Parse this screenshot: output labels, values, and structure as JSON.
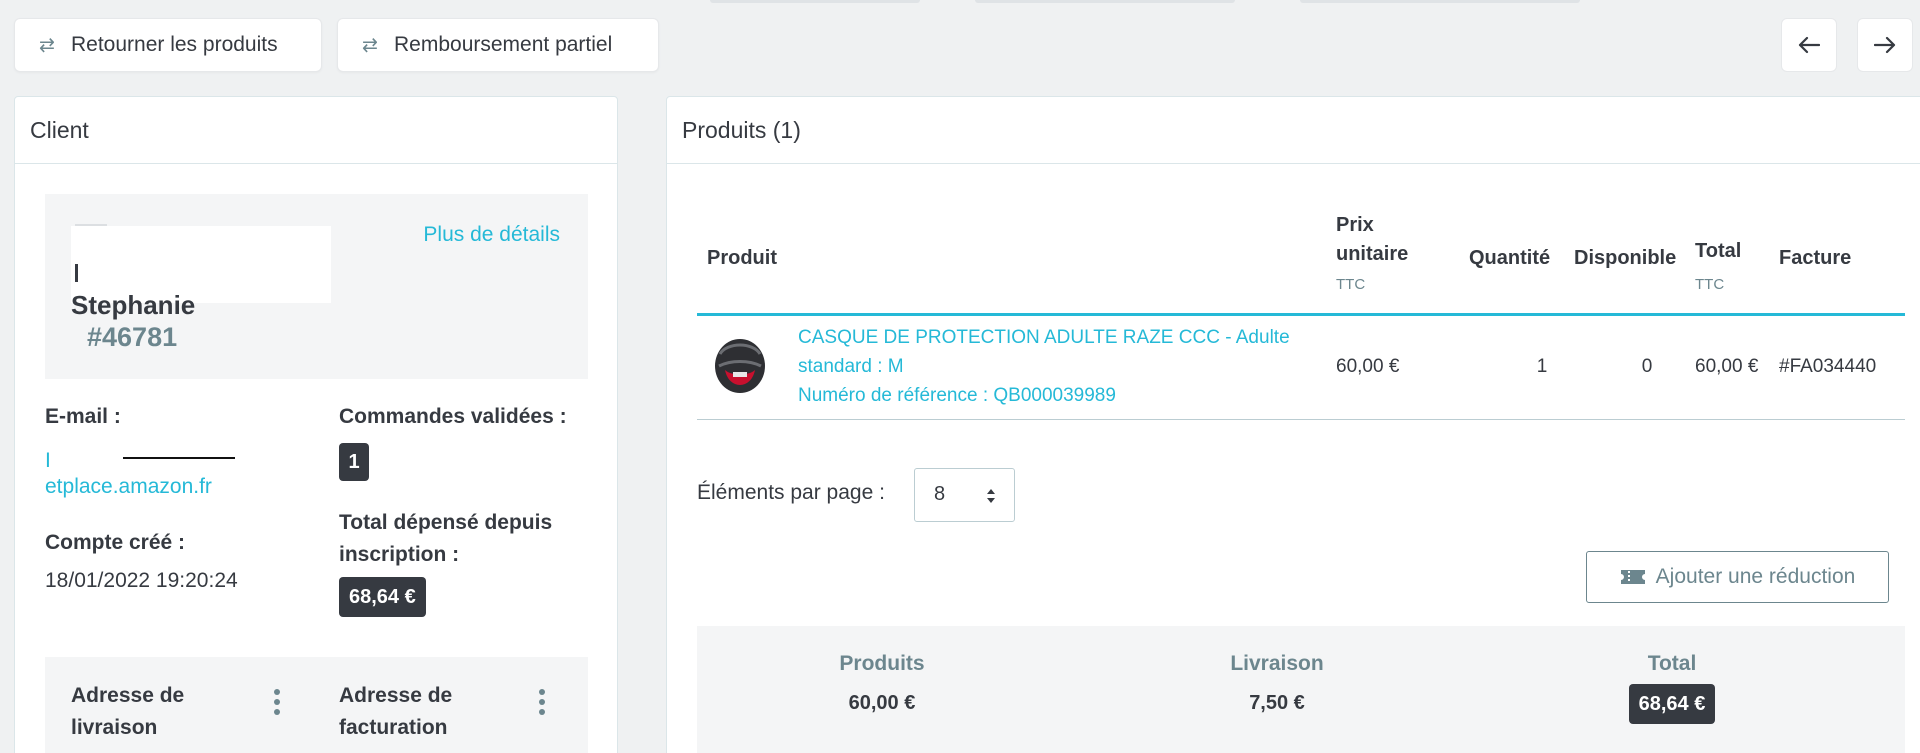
{
  "toolbar": {
    "return_label": "Retourner les produits",
    "refund_label": "Remboursement partiel"
  },
  "customer": {
    "title": "Client",
    "more_details": "Plus de détails",
    "name": "Stephanie",
    "id": "#46781",
    "email_label": "E-mail :",
    "email_line1": "I",
    "email_line2": "etplace.amazon.fr",
    "created_label": "Compte créé :",
    "created_value": "18/01/2022 19:20:24",
    "orders_label": "Commandes validées :",
    "orders_value": "1",
    "spent_label_line1": "Total dépensé depuis",
    "spent_label_line2": "inscription :",
    "spent_value": "68,64 €",
    "shipping_label_line1": "Adresse de",
    "shipping_label_line2": "livraison",
    "billing_label_line1": "Adresse de",
    "billing_label_line2": "facturation"
  },
  "products": {
    "title": "Produits (1)",
    "headers": {
      "product": "Produit",
      "unit_line1": "Prix",
      "unit_line2": "unitaire",
      "unit_sub": "TTC",
      "qty": "Quantité",
      "available": "Disponible",
      "total": "Total",
      "total_sub": "TTC",
      "invoice": "Facture"
    },
    "rows": [
      {
        "name_line1": "CASQUE DE PROTECTION ADULTE RAZE CCC - Adulte",
        "name_line2": "standard : M",
        "reference": "Numéro de référence : QB000039989",
        "unit_price": "60,00 €",
        "quantity": "1",
        "available": "0",
        "total": "60,00 €",
        "invoice": "#FA034440"
      }
    ],
    "per_page_label": "Éléments par page :",
    "per_page_value": "8",
    "add_discount": "Ajouter une réduction",
    "summary": {
      "products_label": "Produits",
      "products_value": "60,00 €",
      "shipping_label": "Livraison",
      "shipping_value": "7,50 €",
      "total_label": "Total",
      "total_value": "68,64 €"
    }
  }
}
